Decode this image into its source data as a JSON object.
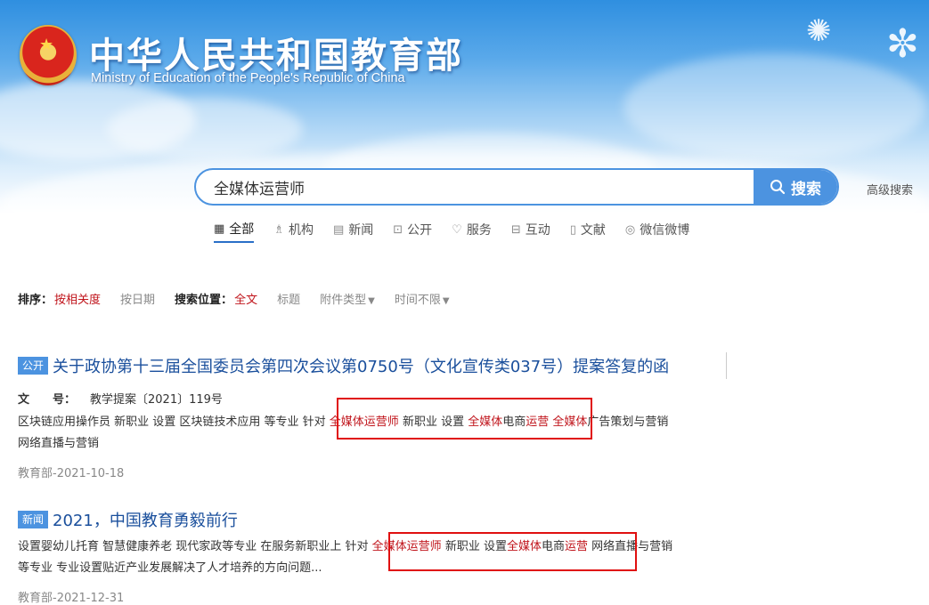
{
  "header": {
    "ministry_cn": "中华人民共和国教育部",
    "ministry_en": "Ministry of Education of the People's Republic of China",
    "emblem_icon": "national-emblem-icon"
  },
  "search": {
    "query": "全媒体运营师",
    "button_label": "搜索",
    "advanced_label": "高级搜索"
  },
  "tabs": [
    {
      "label": "全部",
      "icon": "grid-icon",
      "active": true
    },
    {
      "label": "机构",
      "icon": "org-icon"
    },
    {
      "label": "新闻",
      "icon": "news-icon"
    },
    {
      "label": "公开",
      "icon": "lock-icon"
    },
    {
      "label": "服务",
      "icon": "heart-icon"
    },
    {
      "label": "互动",
      "icon": "chat-icon"
    },
    {
      "label": "文献",
      "icon": "document-icon"
    },
    {
      "label": "微信微博",
      "icon": "wechat-icon"
    }
  ],
  "filters": {
    "sort_label": "排序：",
    "sort_relevance": "按相关度",
    "sort_date": "按日期",
    "position_label": "搜索位置：",
    "pos_full": "全文",
    "pos_title": "标题",
    "attachment_type": "附件类型",
    "time_range": "时间不限"
  },
  "results": [
    {
      "badge": "公开",
      "title": "关于政协第十三届全国委员会第四次会议第0750号（文化宣传类037号）提案答复的函",
      "meta_key": "文　　号：",
      "meta_value": "教学提案〔2021〕119号",
      "body_1": "区块链应用操作员 新职业 设置 区块链技术应用 等专业 针对 ",
      "hl_1": "全媒体运营师",
      "body_2": " 新职业 设置 ",
      "hl_2": "全媒体",
      "body_3": "电商",
      "hl_3": "运营",
      "body_4": " ",
      "hl_4": "全媒体",
      "body_5": "广告策划与营销 网络直播与营销",
      "date": "教育部-2021-10-18"
    },
    {
      "badge": "新闻",
      "title": "2021，中国教育勇毅前行",
      "body_1": "设置婴幼儿托育 智慧健康养老 现代家政等专业 在服务新职业上 针对 ",
      "hl_1": "全媒体运营师",
      "body_2": " 新职业 设置",
      "hl_2": "全媒体",
      "body_3": "电商",
      "hl_3": "运营",
      "body_4": " 网络直播与营销等专业 专业设置贴近产业发展解决了人才培养的方向问题...",
      "date": "教育部-2021-12-31"
    }
  ]
}
